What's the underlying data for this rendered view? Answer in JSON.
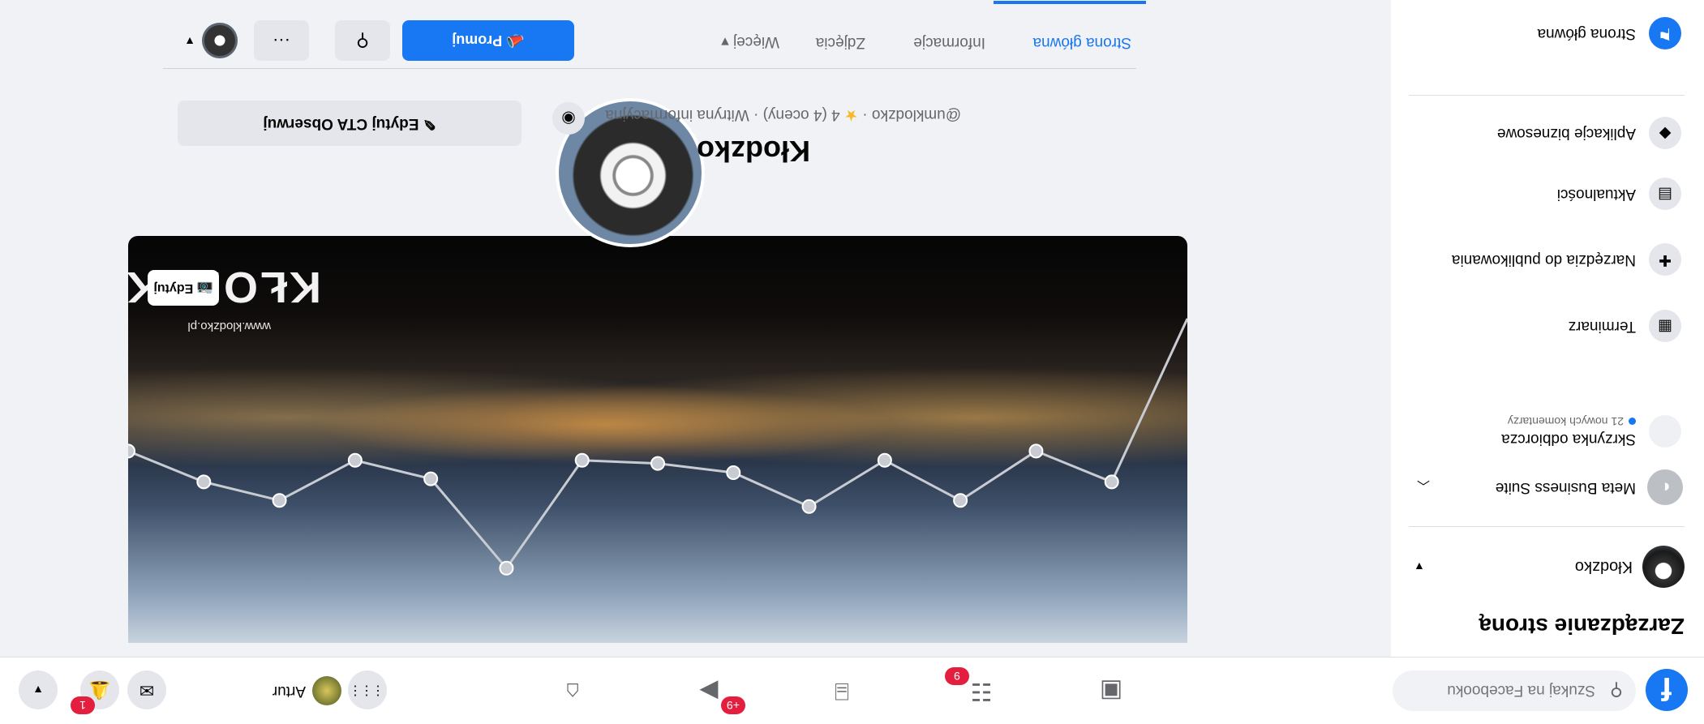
{
  "topnav": {
    "logo": "f",
    "search_placeholder": "Szukaj na Facebooku",
    "tabs": [
      {
        "name": "home",
        "icon": "⌂"
      },
      {
        "name": "video",
        "icon": "▶",
        "badge": "+9"
      },
      {
        "name": "marketplace",
        "icon": "⌸"
      },
      {
        "name": "groups",
        "icon": "☷",
        "badge": "9"
      },
      {
        "name": "gaming",
        "icon": "▣"
      }
    ],
    "user_name": "Artur",
    "menu_icon": "⋮⋮⋮",
    "messenger_icon": "✉",
    "notifications_icon": "🔔",
    "notifications_badge": "1",
    "account_icon": "▼"
  },
  "sidebar": {
    "title": "Zarządzanie stroną",
    "page_name": "Kłodzko",
    "business_suite": "Meta Business Suite",
    "inbox_label": "Skrzynka odbiorcza",
    "inbox_sub": "21 nowych komentarzy",
    "items": [
      {
        "label": "Terminarz",
        "icon": "▦"
      },
      {
        "label": "Narzędzia do publikowania",
        "icon": "✚"
      },
      {
        "label": "Aktualności",
        "icon": "▤"
      },
      {
        "label": "Aplikacje biznesowe",
        "icon": "◆"
      }
    ],
    "home_label": "Strona główna"
  },
  "profile": {
    "name": "Kłodzko",
    "handle_meta_pre": "@umklodzko · ",
    "rating_meta": "4 (4 oceny) · Witryna informacyjna",
    "edit_cta": "Edytuj CTA Obserwuj",
    "cover_edit": "Edytuj",
    "cover_wordmark": "KŁODZKO",
    "cover_url": "www.klodzko.pl"
  },
  "tabs": {
    "home": "Strona główna",
    "info": "Informacje",
    "photos": "Zdjęcia",
    "more": "Więcej ▾",
    "promote": "Promuj",
    "search_icon": "⚲",
    "more_icon": "···"
  },
  "cover_overlay": {
    "points": [
      0,
      5.3,
      4.3,
      5.9,
      4.6,
      6.1,
      5.0,
      4.7,
      4.6,
      8.1,
      5.2,
      4.6,
      5.9,
      5.3,
      4.3
    ]
  },
  "colors": {
    "accent": "#1877f2",
    "badge": "#e41e3f"
  }
}
